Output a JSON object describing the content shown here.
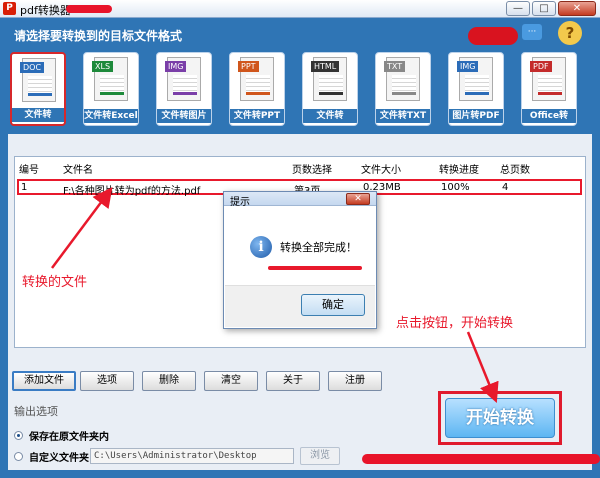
{
  "window": {
    "title": "pdf转换器",
    "minimize_symbol": "—",
    "maximize_symbol": "□",
    "close_symbol": "✕"
  },
  "header": {
    "prompt": "请选择要转换到的目标文件格式",
    "help_symbol": "?"
  },
  "tools": [
    {
      "tag": "DOC",
      "label": "文件转Word",
      "color": "#2b6cb8",
      "selected": true
    },
    {
      "tag": "XLS",
      "label": "文件转Excel",
      "color": "#1e8a3b",
      "selected": false
    },
    {
      "tag": "IMG",
      "label": "文件转图片",
      "color": "#7a3ea8",
      "selected": false
    },
    {
      "tag": "PPT",
      "label": "文件转PPT",
      "color": "#d0561c",
      "selected": false
    },
    {
      "tag": "HTML",
      "label": "文件转HTML",
      "color": "#333333",
      "selected": false
    },
    {
      "tag": "TXT",
      "label": "文件转TXT",
      "color": "#888888",
      "selected": false
    },
    {
      "tag": "IMG",
      "label": "图片转PDF",
      "color": "#2b6cb8",
      "selected": false
    },
    {
      "tag": "PDF",
      "label": "Office转PDF",
      "color": "#c42b2b",
      "selected": false
    }
  ],
  "table": {
    "columns": [
      "编号",
      "文件名",
      "页数选择",
      "文件大小",
      "转换进度",
      "总页数"
    ],
    "rows": [
      {
        "index": "1",
        "filename": "F:\\各种图片转为pdf的方法.pdf",
        "pages": "第3页",
        "size": "0.23MB",
        "progress": "100%",
        "total": "4"
      }
    ]
  },
  "buttons": {
    "add_file": "添加文件",
    "options": "选项",
    "delete": "删除",
    "clear": "清空",
    "about": "关于",
    "register": "注册"
  },
  "output": {
    "section_label": "输出选项",
    "keep_original": "保存在原文件夹内",
    "custom_folder": "自定义文件夹",
    "path_value": "C:\\Users\\Administrator\\Desktop",
    "browse": "浏览"
  },
  "start_button": "开始转换",
  "dialog": {
    "title": "提示",
    "icon_letter": "i",
    "message": "转换全部完成！",
    "ok": "确定"
  },
  "annotations": {
    "converted_file": "转换的文件",
    "click_to_start": "点击按钮，开始转换"
  },
  "colors": {
    "window_blue": "#2f75b5",
    "highlight_red": "#e8192c",
    "start_button_blue": "#5db6f2"
  }
}
